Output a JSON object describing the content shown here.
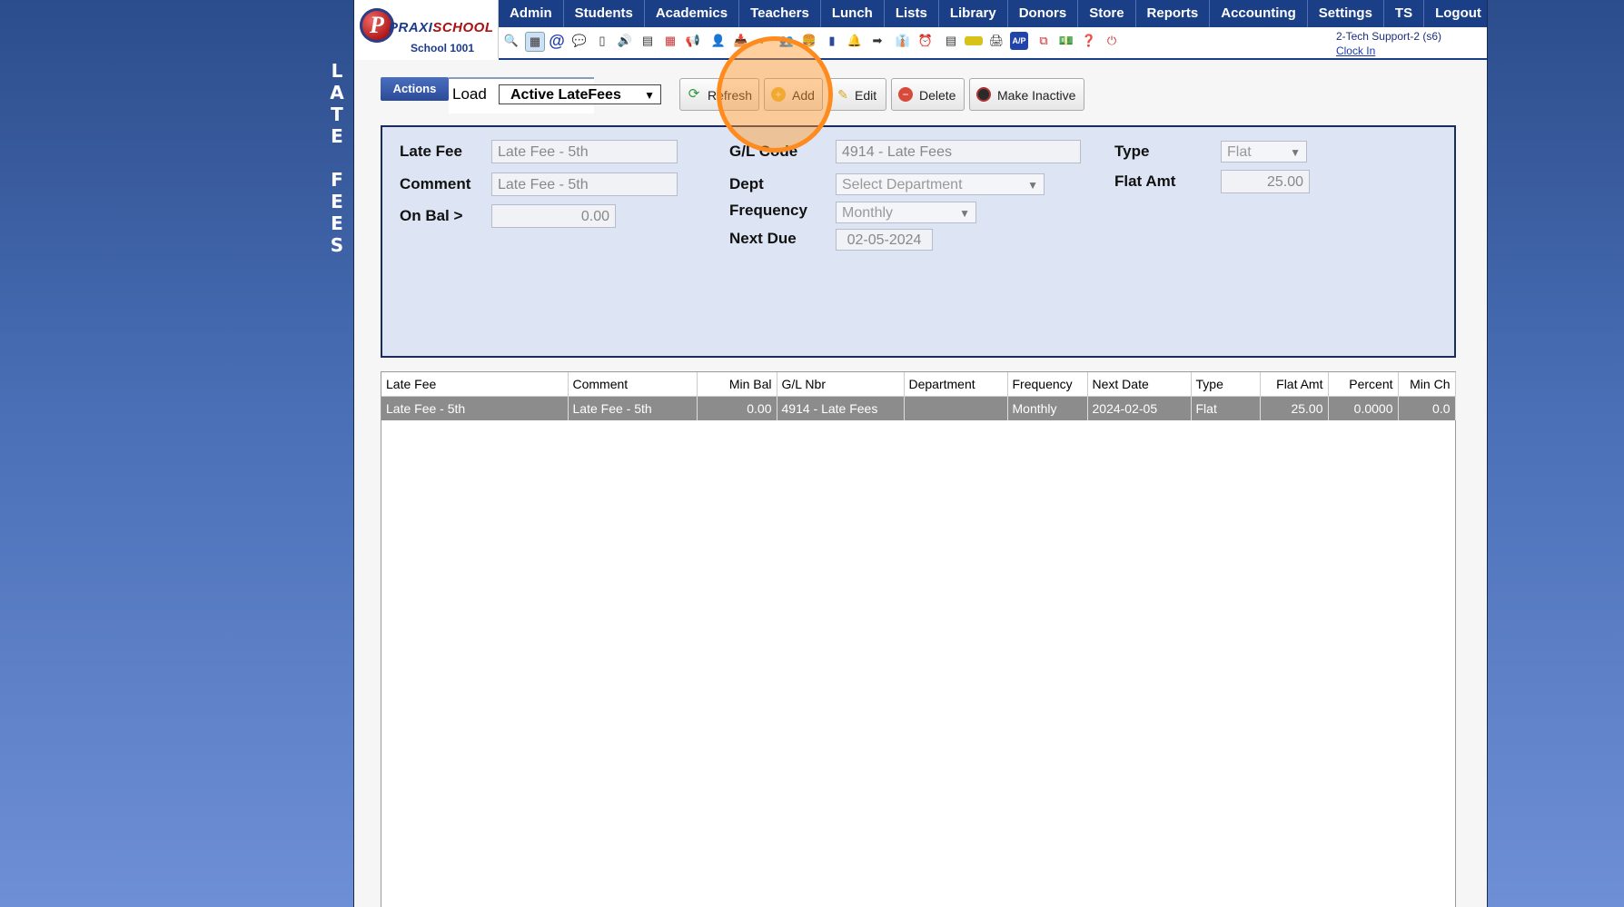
{
  "page_title_vertical": [
    "L",
    "A",
    "T",
    "E",
    " ",
    "F",
    "E",
    "E",
    "S"
  ],
  "logo": {
    "brand_a": "PRAXI",
    "brand_b": "SCHOOL",
    "school": "School 1001",
    "letter": "P"
  },
  "menu": [
    "Admin",
    "Students",
    "Academics",
    "Teachers",
    "Lunch",
    "Lists",
    "Library",
    "Donors",
    "Store",
    "Reports",
    "Accounting",
    "Settings",
    "TS",
    "Logout"
  ],
  "user": {
    "name": "2-Tech Support-2 (s6)",
    "clock_in": "Clock In"
  },
  "toolbar": {
    "actions_label": "Actions",
    "load_label": "Load",
    "load_value": "Active LateFees",
    "refresh_label": "Refresh",
    "add_label": "Add",
    "edit_label": "Edit",
    "delete_label": "Delete",
    "make_inactive_label": "Make Inactive"
  },
  "form": {
    "late_fee_label": "Late Fee",
    "late_fee_value": "Late Fee - 5th",
    "comment_label": "Comment",
    "comment_value": "Late Fee - 5th",
    "on_bal_label": "On Bal >",
    "on_bal_value": "0.00",
    "gl_code_label": "G/L Code",
    "gl_code_value": "4914 - Late Fees",
    "dept_label": "Dept",
    "dept_value": "Select Department",
    "frequency_label": "Frequency",
    "frequency_value": "Monthly",
    "next_due_label": "Next Due",
    "next_due_value": "02-05-2024",
    "type_label": "Type",
    "type_value": "Flat",
    "flat_amt_label": "Flat Amt",
    "flat_amt_value": "25.00"
  },
  "grid": {
    "columns": [
      "Late Fee",
      "Comment",
      "Min Bal",
      "G/L Nbr",
      "Department",
      "Frequency",
      "Next Date",
      "Type",
      "Flat Amt",
      "Percent",
      "Min Ch"
    ],
    "rows": [
      [
        "Late Fee - 5th",
        "Late Fee - 5th",
        "0.00",
        "4914 - Late Fees",
        "",
        "Monthly",
        "2024-02-05",
        "Flat",
        "25.00",
        "0.0000",
        "0.0"
      ]
    ]
  },
  "colors": {
    "menu_bg": "#1b3f86",
    "panel_bg": "#dde5f4",
    "selected_row": "#8c8c8c",
    "highlight": "#ff8a1e"
  }
}
